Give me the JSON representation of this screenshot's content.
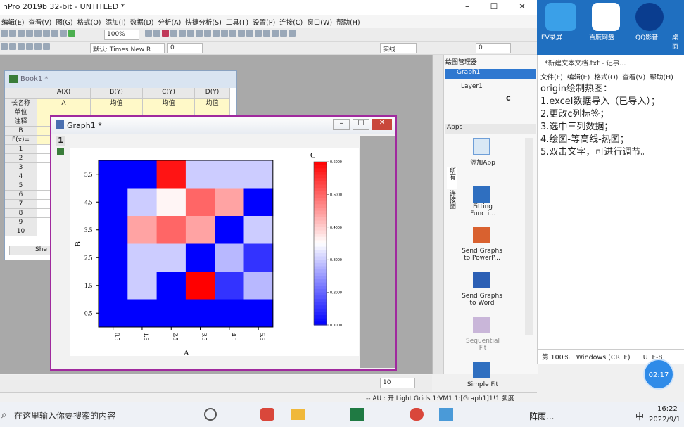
{
  "window": {
    "title": "nPro 2019b 32-bit - UNTITLED *",
    "min": "–",
    "max": "☐",
    "close": "✕"
  },
  "menu": [
    "编辑(E)",
    "查看(V)",
    "图(G)",
    "格式(O)",
    "添加(I)",
    "数据(D)",
    "分析(A)",
    "快捷分析(S)",
    "工具(T)",
    "设置(P)",
    "连接(C)",
    "窗口(W)",
    "帮助(H)"
  ],
  "toolbar": {
    "zoom": "100%",
    "font": "默认: Times New R",
    "font_size": "0",
    "line_style": "实线",
    "line_width": "0"
  },
  "book": {
    "title": "Book1 *",
    "columns": [
      "A(X)",
      "B(Y)",
      "C(Y)",
      "D(Y)"
    ],
    "row_labels": [
      "长名称",
      "单位",
      "注释",
      "B",
      "F(x)="
    ],
    "long_names": [
      "A",
      "均值",
      "均值",
      "均值"
    ],
    "rows": [
      "1",
      "2",
      "3",
      "4",
      "5",
      "6",
      "7",
      "8",
      "9",
      "10"
    ],
    "sheet_tab": "She"
  },
  "graph": {
    "title": "Graph1 *",
    "layer_no": "1",
    "min": "–",
    "max": "☐",
    "close": "✕"
  },
  "chart_data": {
    "type": "heatmap",
    "xlabel": "A",
    "ylabel": "B",
    "x_ticks": [
      "0.5",
      "1.5",
      "2.5",
      "3.5",
      "4.5",
      "5.5"
    ],
    "y_ticks": [
      "5.5",
      "4.5",
      "3.5",
      "2.5",
      "1.5",
      "0.5"
    ],
    "colorbar_title": "C",
    "colorbar_ticks": [
      "0.6000",
      "0.5000",
      "0.4000",
      "0.3000",
      "0.2000",
      "0.1000"
    ],
    "colorbar_range": [
      0.1,
      0.6
    ],
    "grid": [
      [
        0.1,
        0.1,
        0.58,
        0.3,
        0.3,
        0.3
      ],
      [
        0.1,
        0.3,
        0.36,
        0.5,
        0.44,
        0.1
      ],
      [
        0.1,
        0.44,
        0.5,
        0.44,
        0.1,
        0.3
      ],
      [
        0.1,
        0.3,
        0.3,
        0.1,
        0.28,
        0.15
      ],
      [
        0.1,
        0.3,
        0.1,
        0.6,
        0.15,
        0.28
      ],
      [
        0.1,
        0.1,
        0.1,
        0.1,
        0.1,
        0.1
      ]
    ]
  },
  "graph_manager": {
    "title": "绘图管理器",
    "graph": "Graph1",
    "layer": "Layer1",
    "plot": "C"
  },
  "apps": {
    "title": "Apps",
    "tab1": "所有",
    "tab2": "连接图",
    "items": [
      "添加App",
      "Fitting Functi...",
      "Send Graphs to PowerP...",
      "Send Graphs to Word",
      "Sequential Fit",
      "Simple Fit"
    ]
  },
  "desktop_icons": [
    "EV录屏",
    "百度网盘",
    "QQ影音",
    "桌面"
  ],
  "notepad": {
    "title": "*新建文本文档.txt - 记事...",
    "menu": [
      "文件(F)",
      "编辑(E)",
      "格式(O)",
      "查看(V)",
      "帮助(H)"
    ],
    "lines": [
      "origin绘制热图：",
      "1.excel数据导入（已导入）；",
      "2.更改c列标签；",
      "3.选中三列数据；",
      "4.绘图-等高线-热图；",
      "5.双击文字，可进行调节。"
    ],
    "status_zoom": "第 100%",
    "status_eol": "Windows (CRLF)",
    "status_enc": "UTF-8"
  },
  "timer": "02:17",
  "status_text": "-- AU : 开 Light Grids 1:VM1 1:[Graph1]1!1 弧度",
  "bottom_combo": "10",
  "taskbar": {
    "search": "在这里输入你要搜索的内容",
    "weather": "阵雨...",
    "ime": "中",
    "time": "16:22",
    "date": "2022/9/1"
  }
}
